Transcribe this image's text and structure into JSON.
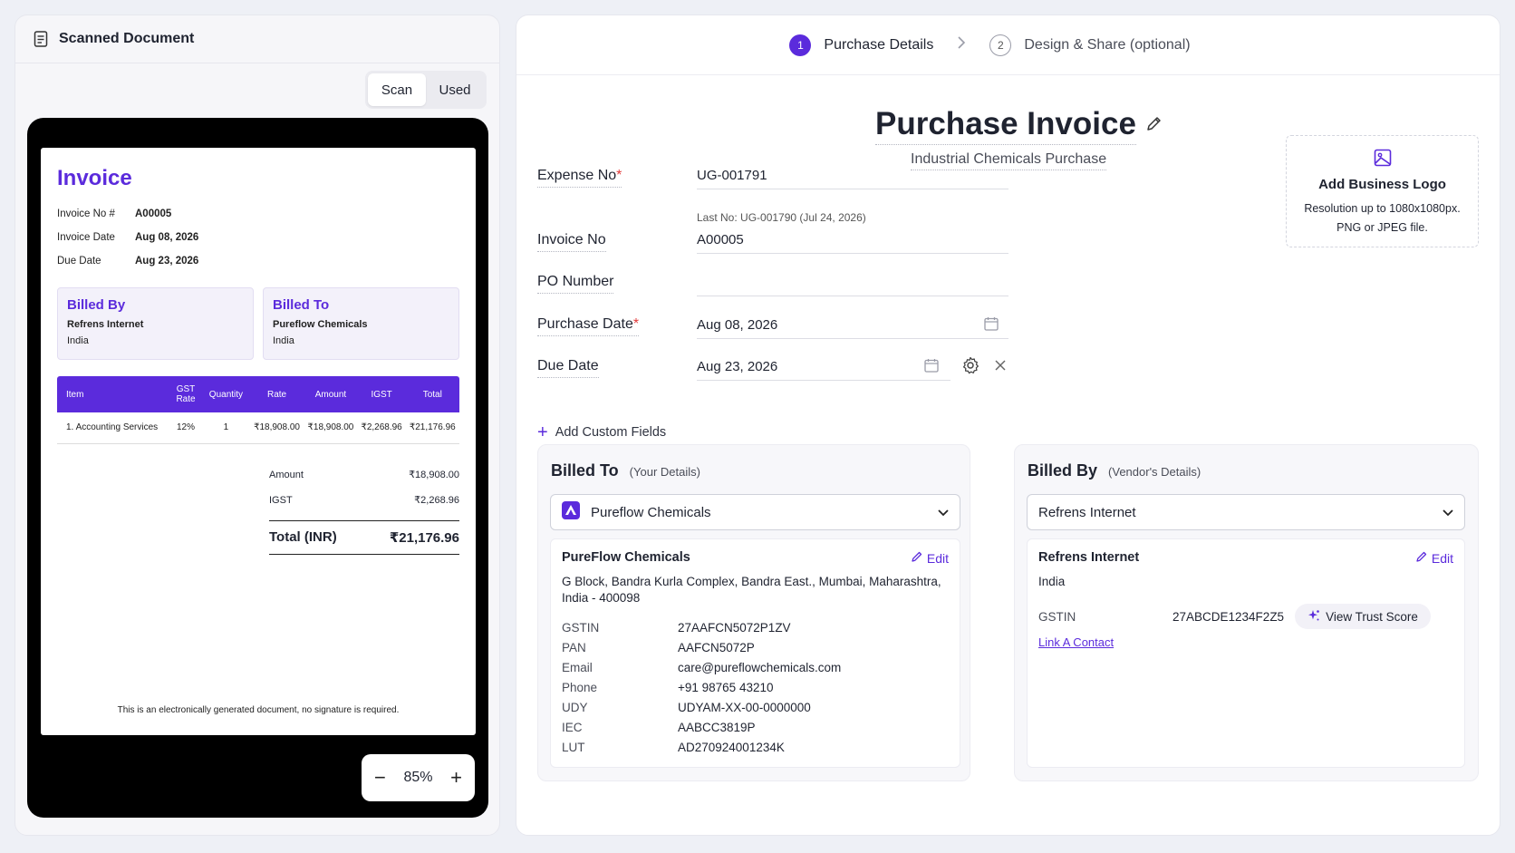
{
  "left_panel": {
    "title": "Scanned Document",
    "tabs": [
      {
        "label": "Scan"
      },
      {
        "label": "Used"
      }
    ],
    "zoom": {
      "value": "85%",
      "minus": "−",
      "plus": "+"
    }
  },
  "invoice_preview": {
    "title": "Invoice",
    "meta": [
      {
        "label": "Invoice No #",
        "value": "A00005"
      },
      {
        "label": "Invoice Date",
        "value": "Aug 08, 2026"
      },
      {
        "label": "Due Date",
        "value": "Aug 23, 2026"
      }
    ],
    "billed_by": {
      "title": "Billed By",
      "name": "Refrens Internet",
      "country": "India"
    },
    "billed_to": {
      "title": "Billed To",
      "name": "Pureflow Chemicals",
      "country": "India"
    },
    "table": {
      "headers": [
        "Item",
        "GST Rate",
        "Quantity",
        "Rate",
        "Amount",
        "IGST",
        "Total"
      ],
      "rows": [
        [
          "1.   Accounting Services",
          "12%",
          "1",
          "₹18,908.00",
          "₹18,908.00",
          "₹2,268.96",
          "₹21,176.96"
        ]
      ]
    },
    "totals": [
      {
        "label": "Amount",
        "value": "₹18,908.00"
      },
      {
        "label": "IGST",
        "value": "₹2,268.96"
      }
    ],
    "grand_total": {
      "label": "Total (INR)",
      "value": "₹21,176.96"
    },
    "footer": "This is an electronically generated document, no signature is required."
  },
  "steps": [
    {
      "num": "1",
      "label": "Purchase Details"
    },
    {
      "num": "2",
      "label": "Design & Share (optional)"
    }
  ],
  "form": {
    "title": "Purchase Invoice",
    "subtitle": "Industrial Chemicals Purchase",
    "logo": {
      "title": "Add Business Logo",
      "desc1": "Resolution up to 1080x1080px.",
      "desc2": "PNG or JPEG file."
    },
    "expense_no": {
      "label": "Expense No",
      "value": "UG-001791",
      "hint": "Last No: UG-001790 (Jul 24, 2026)"
    },
    "invoice_no": {
      "label": "Invoice No",
      "value": "A00005"
    },
    "po_number": {
      "label": "PO Number",
      "value": ""
    },
    "purchase_date": {
      "label": "Purchase Date",
      "value": "Aug 08, 2026"
    },
    "due_date": {
      "label": "Due Date",
      "value": "Aug 23, 2026"
    },
    "add_custom": "Add Custom Fields",
    "required_mark": "*"
  },
  "billed_to_card": {
    "title": "Billed To",
    "subtitle": "(Your Details)",
    "selected": "Pureflow Chemicals",
    "name": "PureFlow Chemicals",
    "edit": "Edit",
    "address": "G Block, Bandra Kurla Complex, Bandra East., Mumbai, Maharashtra, India - 400098",
    "details": [
      {
        "k": "GSTIN",
        "v": "27AAFCN5072P1ZV"
      },
      {
        "k": "PAN",
        "v": "AAFCN5072P"
      },
      {
        "k": "Email",
        "v": "care@pureflowchemicals.com"
      },
      {
        "k": "Phone",
        "v": "+91 98765 43210"
      },
      {
        "k": "UDY",
        "v": "UDYAM-XX-00-0000000"
      },
      {
        "k": "IEC",
        "v": "AABCC3819P"
      },
      {
        "k": "LUT",
        "v": "AD270924001234K"
      }
    ]
  },
  "billed_by_card": {
    "title": "Billed By",
    "subtitle": "(Vendor's Details)",
    "selected": "Refrens Internet",
    "name": "Refrens Internet",
    "edit": "Edit",
    "country": "India",
    "gstin_label": "GSTIN",
    "gstin": "27ABCDE1234F2Z5",
    "trust_score": "View Trust Score",
    "link_contact": "Link A Contact"
  },
  "colors": {
    "accent": "#5b2bdc",
    "required": "#e23b3b"
  }
}
